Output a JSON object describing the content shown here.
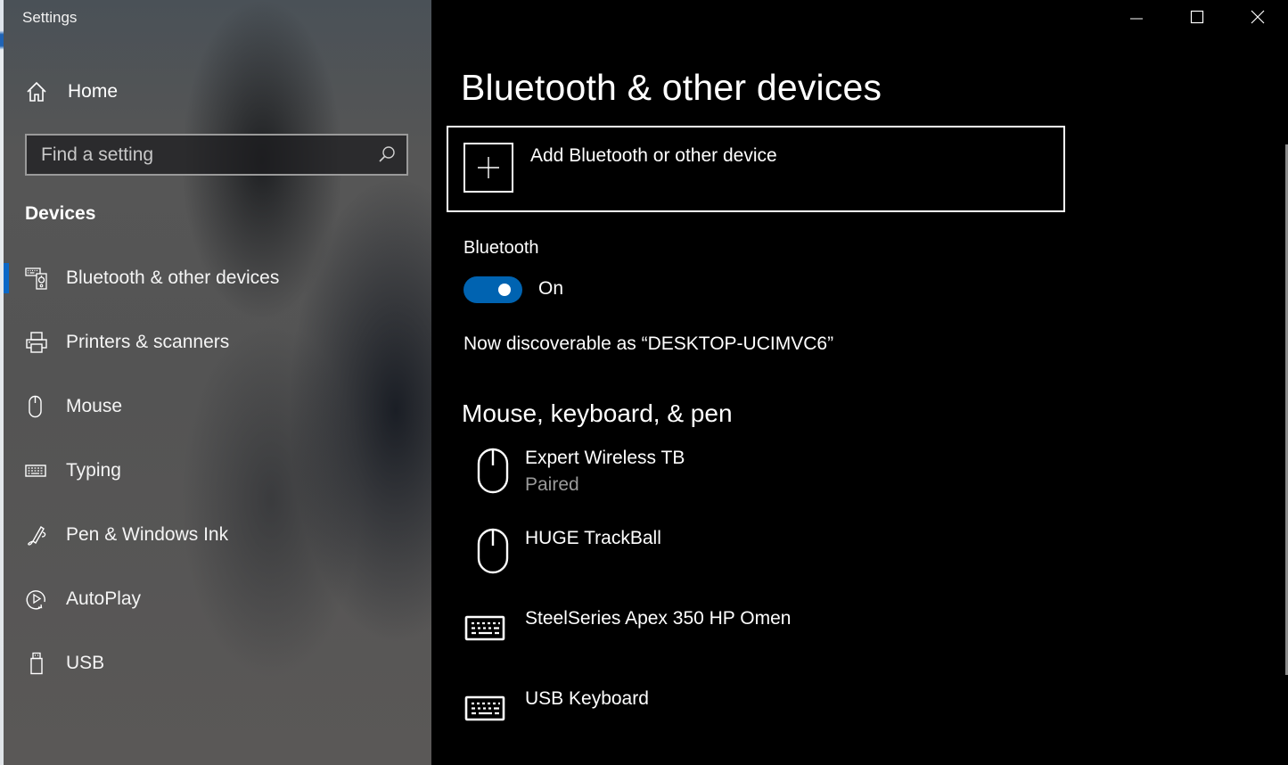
{
  "window": {
    "title": "Settings",
    "controls": {
      "minimize": "minimize-icon",
      "maximize": "maximize-icon",
      "close": "close-icon"
    }
  },
  "sidebar": {
    "home_label": "Home",
    "search_placeholder": "Find a setting",
    "search_value": "",
    "section_title": "Devices",
    "items": [
      {
        "label": "Bluetooth & other devices",
        "icon": "bluetooth-devices-icon",
        "selected": true
      },
      {
        "label": "Printers & scanners",
        "icon": "printer-icon",
        "selected": false
      },
      {
        "label": "Mouse",
        "icon": "mouse-icon",
        "selected": false
      },
      {
        "label": "Typing",
        "icon": "keyboard-icon",
        "selected": false
      },
      {
        "label": "Pen & Windows Ink",
        "icon": "pen-icon",
        "selected": false
      },
      {
        "label": "AutoPlay",
        "icon": "autoplay-icon",
        "selected": false
      },
      {
        "label": "USB",
        "icon": "usb-icon",
        "selected": false
      }
    ]
  },
  "main": {
    "title": "Bluetooth & other devices",
    "add_device_label": "Add Bluetooth or other device",
    "bluetooth": {
      "label": "Bluetooth",
      "enabled": true,
      "state_label": "On",
      "accent_color": "#0063b1"
    },
    "discoverable_text": "Now discoverable as “DESKTOP-UCIMVC6”",
    "section_title": "Mouse, keyboard, & pen",
    "devices": [
      {
        "name": "Expert Wireless TB",
        "status": "Paired",
        "icon": "mouse-icon"
      },
      {
        "name": "HUGE TrackBall",
        "status": "",
        "icon": "mouse-icon"
      },
      {
        "name": "SteelSeries Apex 350 HP Omen",
        "status": "",
        "icon": "keyboard-icon"
      },
      {
        "name": "USB Keyboard",
        "status": "",
        "icon": "keyboard-icon"
      }
    ]
  }
}
